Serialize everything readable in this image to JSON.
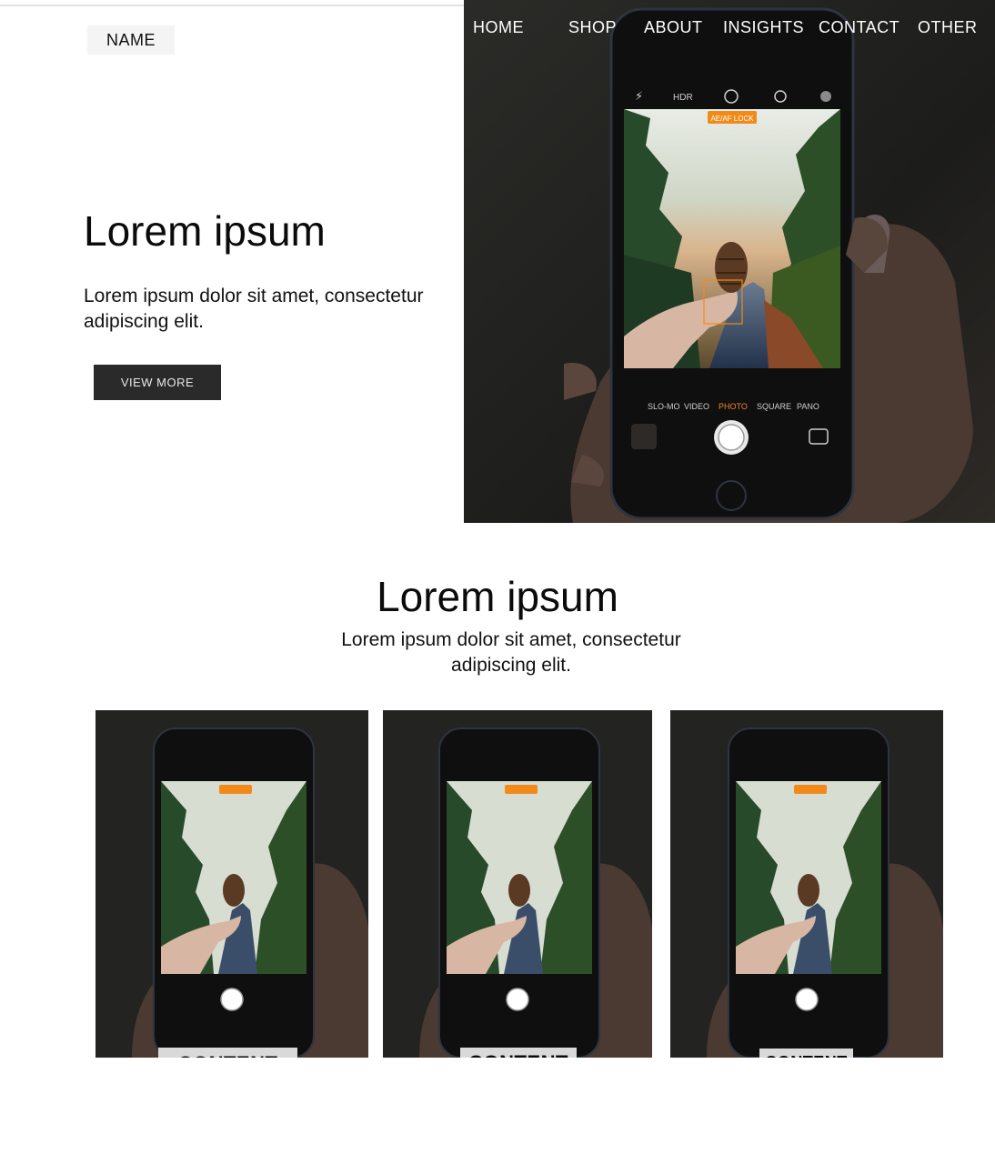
{
  "brand": {
    "name": "NAME"
  },
  "nav": {
    "items": [
      {
        "label": "HOME"
      },
      {
        "label": "SHOP"
      },
      {
        "label": "ABOUT"
      },
      {
        "label": "INSIGHTS"
      },
      {
        "label": "CONTACT"
      },
      {
        "label": "OTHER"
      }
    ]
  },
  "hero": {
    "title": "Lorem ipsum",
    "subtitle": "Lorem ipsum dolor sit amet, consectetur adipiscing elit.",
    "button_label": "VIEW MORE",
    "camera_ui": {
      "flash_icon": "flash-icon",
      "hdr_label": "HDR",
      "lock_badge": "AE/AF LOCK",
      "modes": [
        "SLO-MO",
        "VIDEO",
        "PHOTO",
        "SQUARE",
        "PANO"
      ],
      "active_mode": "PHOTO"
    }
  },
  "section": {
    "title": "Lorem ipsum",
    "subtitle": "Lorem ipsum dolor sit amet, consectetur adipiscing elit."
  },
  "cards": [
    {
      "label": "CONTENT"
    },
    {
      "label": "CONTENT"
    },
    {
      "label": "CONTENT"
    }
  ],
  "colors": {
    "accent_orange": "#f28a1a",
    "button_bg": "#2a2a2a",
    "label_bg": "#d9d9d9",
    "photo_dark": "#1f1f1d"
  }
}
